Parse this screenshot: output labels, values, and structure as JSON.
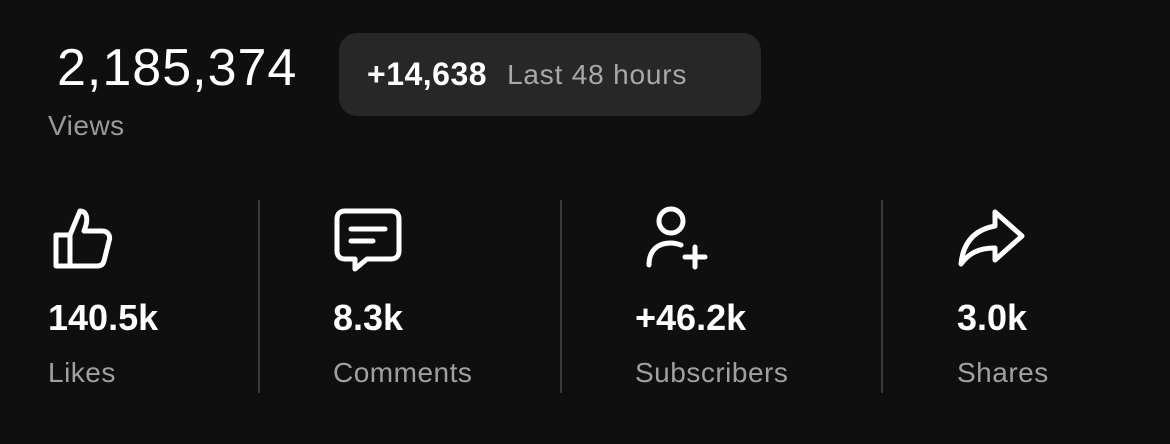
{
  "views": {
    "count": "2,185,374",
    "label": "Views"
  },
  "recent": {
    "delta": "+14,638",
    "period": "Last 48 hours"
  },
  "stats": [
    {
      "icon": "thumbs-up-icon",
      "value": "140.5k",
      "label": "Likes"
    },
    {
      "icon": "comment-icon",
      "value": "8.3k",
      "label": "Comments"
    },
    {
      "icon": "add-user-icon",
      "value": "+46.2k",
      "label": "Subscribers"
    },
    {
      "icon": "share-icon",
      "value": "3.0k",
      "label": "Shares"
    }
  ],
  "colors": {
    "background": "#0f0f0f",
    "pill": "#272727",
    "primary_text": "#ffffff",
    "secondary_text": "#a0a0a0",
    "divider": "#3a3a3a"
  }
}
